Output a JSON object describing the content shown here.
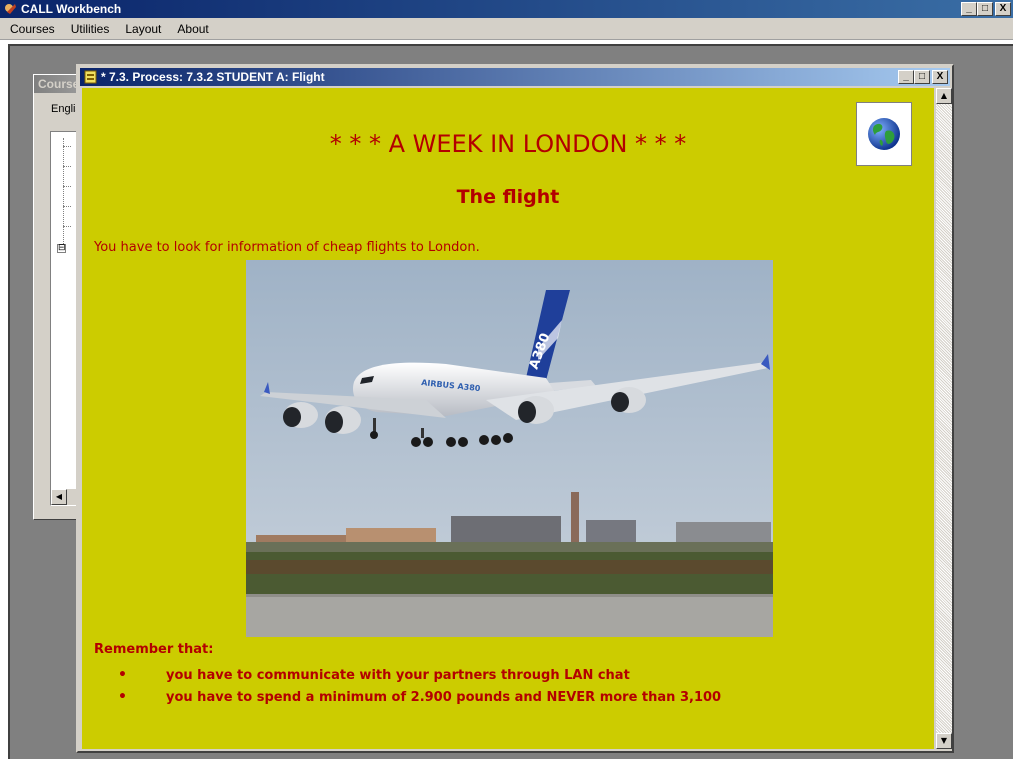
{
  "app": {
    "title": "CALL Workbench",
    "controls": {
      "minimize": "_",
      "maximize": "□",
      "close": "X"
    }
  },
  "menu": [
    "Courses",
    "Utilities",
    "Layout",
    "About"
  ],
  "courses_window": {
    "title": "Courses",
    "label": "English",
    "tree_expander": "⊟"
  },
  "child_window": {
    "title": "* 7.3. Process: 7.3.2 STUDENT A: Flight",
    "controls": {
      "minimize": "_",
      "maximize": "□",
      "close": "X"
    }
  },
  "content": {
    "heading": "* * *  A WEEK IN LONDON * * *",
    "subheading": "The flight",
    "intro": "You have to look for information of cheap flights to London.",
    "photo_text": "AIRBUS A380",
    "photo_tail_text": "A380",
    "remember_label": "Remember that:",
    "bullets": [
      "you have to communicate with your partners through LAN chat",
      "you have to spend a minimum of 2.900 pounds and NEVER more than 3,100"
    ]
  },
  "colors": {
    "content_background": "#cccc00",
    "text_red": "#b30000",
    "titlebar_blue": "#0a246a"
  }
}
